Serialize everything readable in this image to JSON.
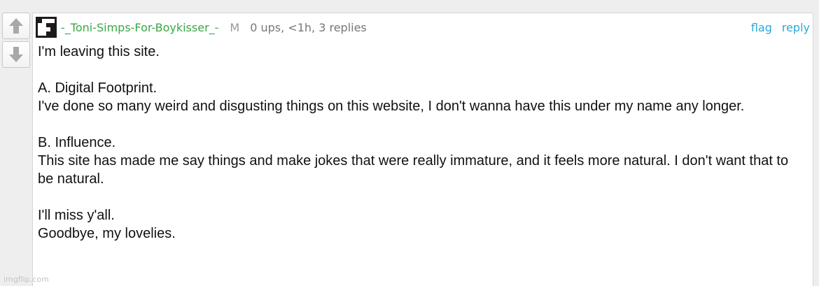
{
  "vote": {
    "up_icon": "arrow-up-icon",
    "down_icon": "arrow-down-icon"
  },
  "comment": {
    "username": "-_Toni-Simps-For-Boykisser_-",
    "badge": "M",
    "meta": "0 ups, <1h, 3 replies",
    "actions": {
      "flag": "flag",
      "reply": "reply"
    },
    "body": {
      "p1": "I'm leaving this site.",
      "p2a": "A. Digital Footprint.",
      "p2b": "I've done so many weird and disgusting things on this website, I don't wanna have this under my name any longer.",
      "p3a": "B. Influence.",
      "p3b": "This site has made me say things and make jokes that were really immature, and it feels more natural. I don't want that to be natural.",
      "p4a": "I'll miss y'all.",
      "p4b": "Goodbye, my lovelies."
    }
  },
  "watermark": "imgflip.com",
  "colors": {
    "username": "#3aa845",
    "link": "#2aa9d6",
    "meta": "#777777",
    "page_bg": "#eeeeee"
  }
}
